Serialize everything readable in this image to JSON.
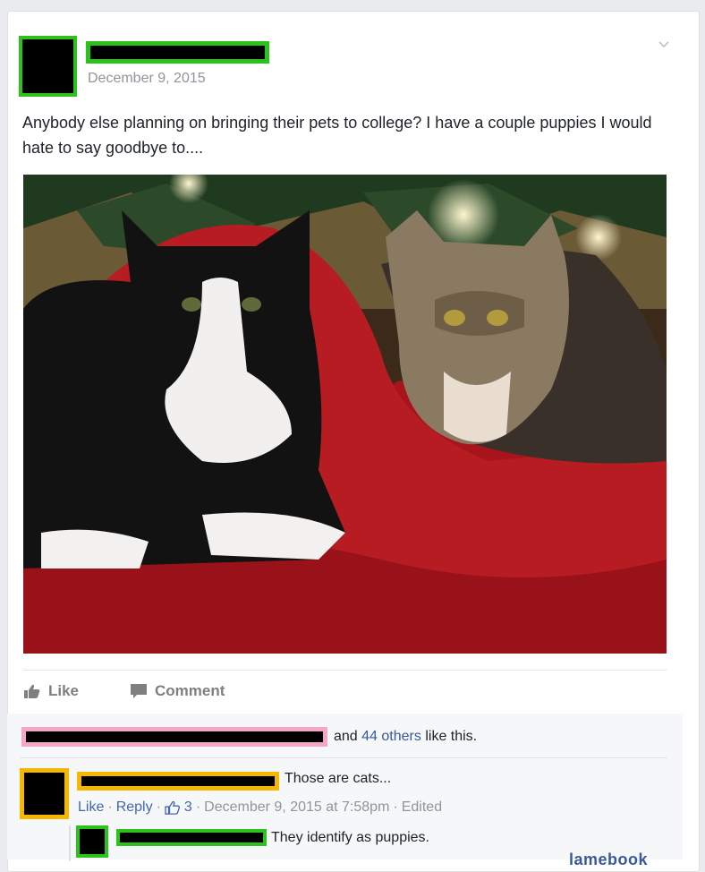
{
  "post": {
    "date": "December 9, 2015",
    "text": "Anybody else planning on bringing their pets to college? I have a couple puppies I would hate to say goodbye to....",
    "photo_icon": "photo-two-cats-on-red-blanket"
  },
  "actions": {
    "like_label": "Like",
    "comment_label": "Comment"
  },
  "likes": {
    "prefix": "and",
    "count_text": "44 others",
    "suffix": "like this."
  },
  "comment": {
    "text": "Those are cats...",
    "like_label": "Like",
    "reply_label": "Reply",
    "reaction_count": "3",
    "timestamp": "December 9, 2015 at 7:58pm",
    "edited_label": "Edited"
  },
  "reply": {
    "text": "They identify as puppies."
  },
  "watermark": "lamebook",
  "colors": {
    "redact_green": "#2bc21c",
    "redact_yellow": "#f5b800",
    "redact_pink": "#f4a6c4",
    "link_blue": "#4267b2"
  }
}
